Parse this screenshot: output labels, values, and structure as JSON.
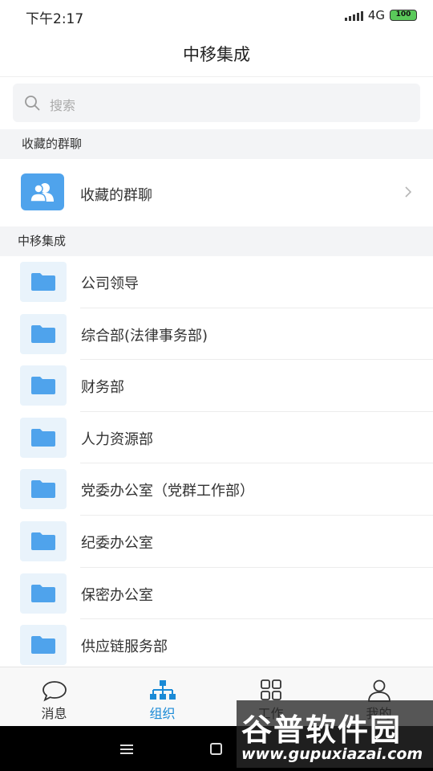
{
  "status_bar": {
    "time": "下午2:17",
    "network": "4G",
    "battery": "100"
  },
  "header": {
    "title": "中移集成"
  },
  "search": {
    "placeholder": "搜索"
  },
  "favorites_section": {
    "header": "收藏的群聊",
    "item_label": "收藏的群聊"
  },
  "org_section": {
    "header": "中移集成",
    "departments": [
      {
        "label": "公司领导"
      },
      {
        "label": "综合部(法律事务部)"
      },
      {
        "label": "财务部"
      },
      {
        "label": "人力资源部"
      },
      {
        "label": "党委办公室（党群工作部）"
      },
      {
        "label": "纪委办公室"
      },
      {
        "label": "保密办公室"
      },
      {
        "label": "供应链服务部"
      }
    ]
  },
  "tabs": [
    {
      "label": "消息",
      "icon": "chat-bubble-icon"
    },
    {
      "label": "组织",
      "icon": "org-chart-icon"
    },
    {
      "label": "工作",
      "icon": "grid-icon"
    },
    {
      "label": "我的",
      "icon": "person-icon"
    }
  ],
  "watermark": {
    "title": "谷普软件园",
    "url": "www.gupuxiazai.com"
  },
  "colors": {
    "accent": "#1a8ad6",
    "folder": "#4fa3ec",
    "section_bg": "#f3f4f6"
  }
}
